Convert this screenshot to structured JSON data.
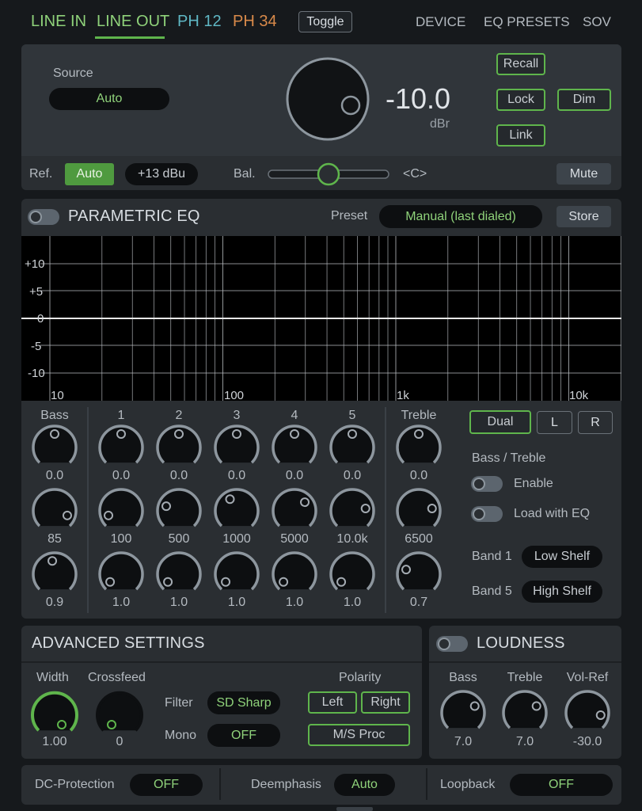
{
  "nav": {
    "tabs": [
      {
        "label": "LINE IN",
        "color": "#8fd27a"
      },
      {
        "label": "LINE OUT",
        "color": "#8fd27a"
      },
      {
        "label": "PH 12",
        "color": "#5fb7c4"
      },
      {
        "label": "PH 34",
        "color": "#d98a4a"
      }
    ],
    "toggle_label": "Toggle",
    "right_links": [
      "DEVICE",
      "EQ PRESETS",
      "SOV"
    ]
  },
  "volume": {
    "source_label": "Source",
    "source_value": "Auto",
    "value": "-10.0",
    "unit": "dBr",
    "recall": "Recall",
    "lock": "Lock",
    "dim": "Dim",
    "link": "Link",
    "ref_label": "Ref.",
    "ref_auto": "Auto",
    "ref_level": "+13 dBu",
    "bal_label": "Bal.",
    "bal_value": "<C>",
    "bal_position": 0.5,
    "mute": "Mute"
  },
  "peq": {
    "title": "PARAMETRIC EQ",
    "preset_label": "Preset",
    "preset_value": "Manual (last dialed)",
    "store": "Store",
    "y_labels": [
      "+10",
      "+5",
      "0",
      "-5",
      "-10"
    ],
    "x_labels": [
      "10",
      "100",
      "1k",
      "10k"
    ],
    "columns": [
      {
        "header": "Bass",
        "gain": "0.0",
        "freq": "85",
        "q": "0.9"
      },
      {
        "header": "1",
        "gain": "0.0",
        "freq": "100",
        "q": "1.0"
      },
      {
        "header": "2",
        "gain": "0.0",
        "freq": "500",
        "q": "1.0"
      },
      {
        "header": "3",
        "gain": "0.0",
        "freq": "1000",
        "q": "1.0"
      },
      {
        "header": "4",
        "gain": "0.0",
        "freq": "5000",
        "q": "1.0"
      },
      {
        "header": "5",
        "gain": "0.0",
        "freq": "10.0k",
        "q": "1.0"
      },
      {
        "header": "Treble",
        "gain": "0.0",
        "freq": "6500",
        "q": "0.7"
      }
    ],
    "dual": "Dual",
    "left": "L",
    "right": "R",
    "bass_treble_label": "Bass / Treble",
    "enable": "Enable",
    "load_with_eq": "Load with EQ",
    "band1_label": "Band 1",
    "band1_value": "Low Shelf",
    "band5_label": "Band 5",
    "band5_value": "High Shelf"
  },
  "advanced": {
    "title": "ADVANCED SETTINGS",
    "width_label": "Width",
    "width_value": "1.00",
    "crossfeed_label": "Crossfeed",
    "crossfeed_value": "0",
    "filter_label": "Filter",
    "filter_value": "SD Sharp",
    "mono_label": "Mono",
    "mono_value": "OFF",
    "polarity_label": "Polarity",
    "pol_left": "Left",
    "pol_right": "Right",
    "ms_proc": "M/S Proc"
  },
  "loudness": {
    "title": "LOUDNESS",
    "bass_label": "Bass",
    "bass_value": "7.0",
    "treble_label": "Treble",
    "treble_value": "7.0",
    "volref_label": "Vol-Ref",
    "volref_value": "-30.0"
  },
  "footer": {
    "dc_label": "DC-Protection",
    "dc_value": "OFF",
    "deemph_label": "Deemphasis",
    "deemph_value": "Auto",
    "loopback_label": "Loopback",
    "loopback_value": "OFF"
  },
  "colors": {
    "accent_green": "#5fb54c",
    "text_green": "#8fd27a",
    "panel": "#2a2e32"
  }
}
